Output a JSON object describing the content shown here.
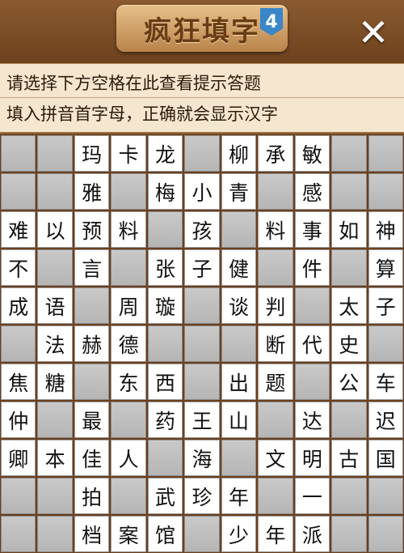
{
  "header": {
    "logo_text": "疯狂填字",
    "logo_badge": "4",
    "close_icon": "close-icon"
  },
  "hints": {
    "line1": "请选择下方空格在此查看提示答题",
    "line2": "填入拼音首字母，正确就会显示汉字"
  },
  "grid": {
    "rows": [
      [
        "",
        "",
        "玛",
        "卡",
        "龙",
        "",
        "柳",
        "承",
        "敏",
        "",
        ""
      ],
      [
        "",
        "",
        "雅",
        "",
        "梅",
        "小",
        "青",
        "",
        "感",
        "",
        ""
      ],
      [
        "难",
        "以",
        "预",
        "料",
        "",
        "孩",
        "",
        "料",
        "事",
        "如",
        "神"
      ],
      [
        "不",
        "",
        "言",
        "",
        "张",
        "子",
        "健",
        "",
        "件",
        "",
        "算"
      ],
      [
        "成",
        "语",
        "",
        "周",
        "璇",
        "",
        "谈",
        "判",
        "",
        "太",
        "子"
      ],
      [
        "",
        "法",
        "赫",
        "德",
        "",
        "",
        "",
        "断",
        "代",
        "史",
        ""
      ],
      [
        "焦",
        "糖",
        "",
        "东",
        "西",
        "",
        "出",
        "题",
        "",
        "公",
        "车"
      ],
      [
        "仲",
        "",
        "最",
        "",
        "药",
        "王",
        "山",
        "",
        "达",
        "",
        "迟"
      ],
      [
        "卿",
        "本",
        "佳",
        "人",
        "",
        "海",
        "",
        "文",
        "明",
        "古",
        "国"
      ],
      [
        "",
        "",
        "拍",
        "",
        "武",
        "珍",
        "年",
        "",
        "一",
        "",
        ""
      ],
      [
        "",
        "",
        "档",
        "案",
        "馆",
        "",
        "少",
        "年",
        "派",
        "",
        ""
      ]
    ]
  }
}
